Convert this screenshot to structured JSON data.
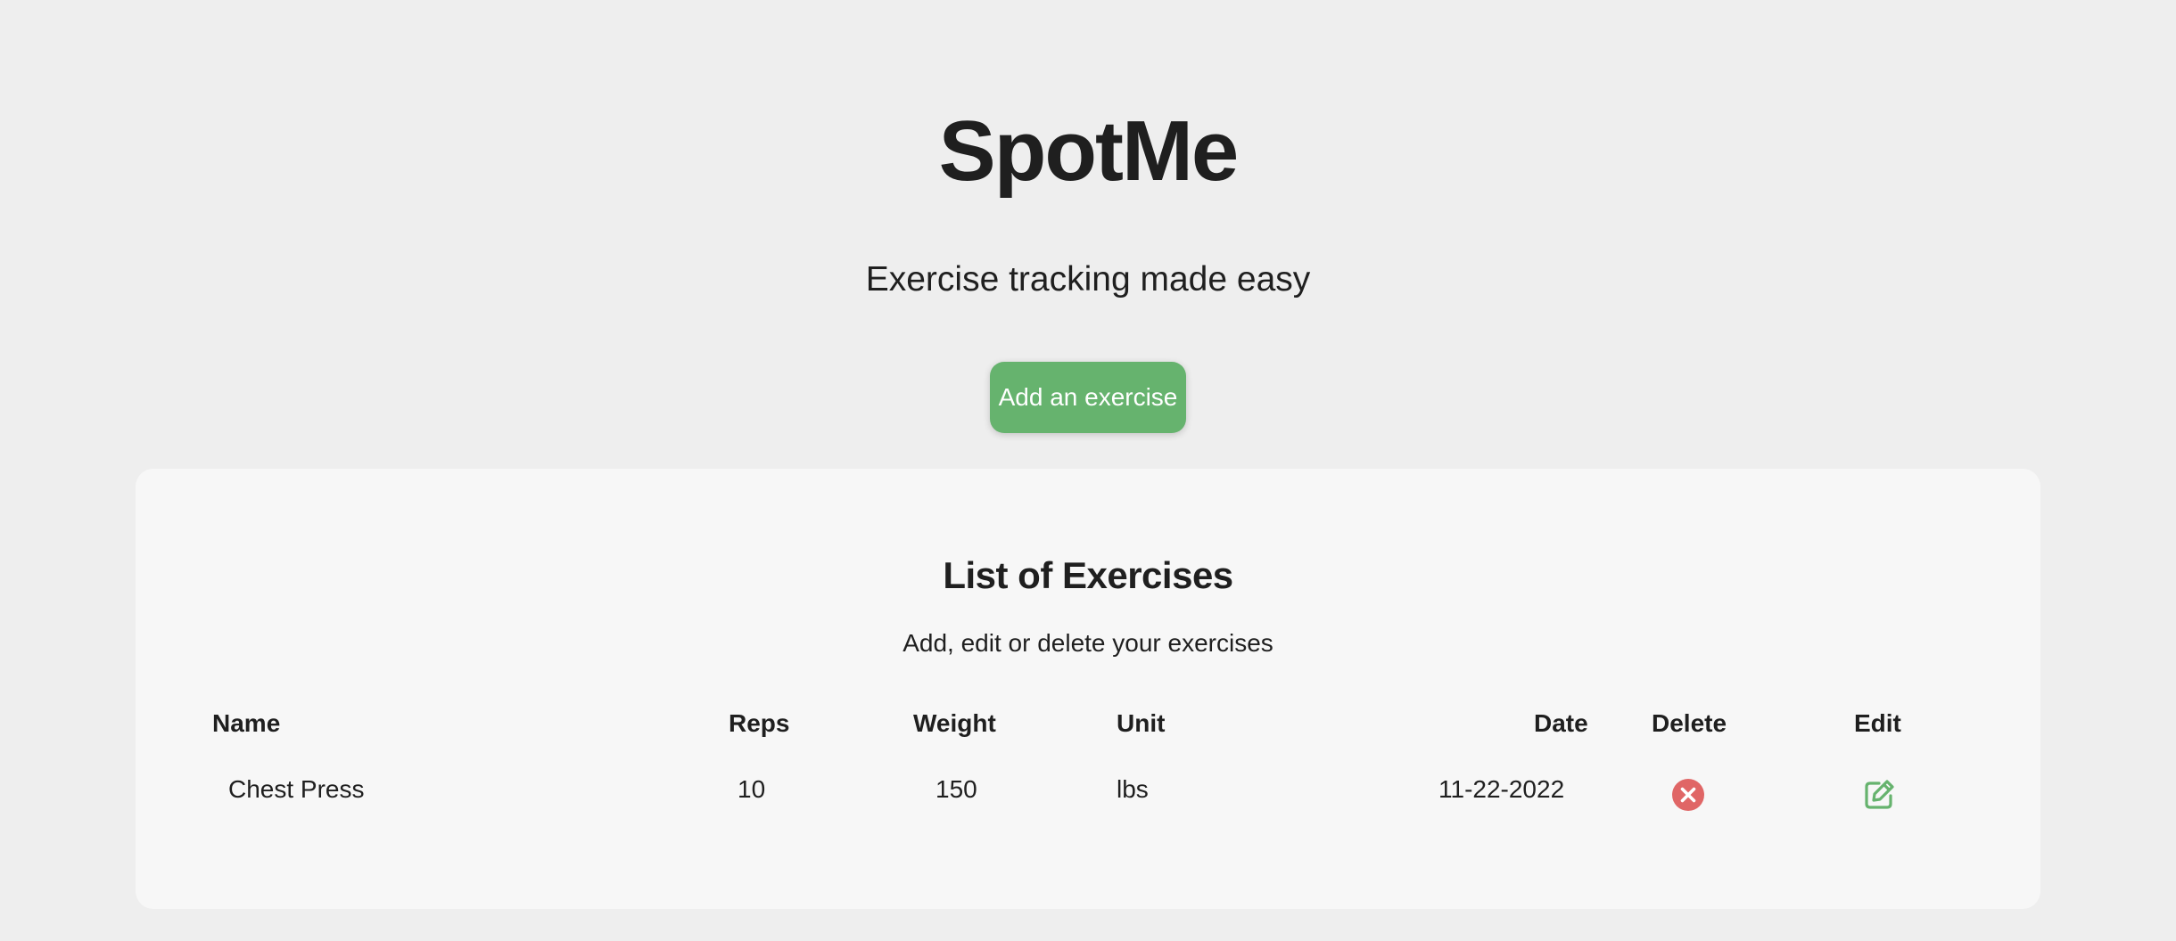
{
  "app": {
    "title": "SpotMe",
    "tagline": "Exercise tracking made easy"
  },
  "actions": {
    "add_label": "Add an exercise"
  },
  "exercises_card": {
    "title": "List of Exercises",
    "subtitle": "Add, edit or delete your exercises",
    "columns": [
      "Name",
      "Reps",
      "Weight",
      "Unit",
      "Date",
      "Delete",
      "Edit"
    ],
    "rows": [
      {
        "name": "Chest Press",
        "reps": "10",
        "weight": "150",
        "unit": "lbs",
        "date": "11-22-2022",
        "delete_icon": "circle-x-icon",
        "edit_icon": "pencil-square-icon"
      }
    ]
  },
  "colors": {
    "page_background": "#eeeeee",
    "card_background": "#f7f7f7",
    "accent_green": "#66b36e",
    "delete_red": "#e06666",
    "text": "#1f1f1f"
  }
}
